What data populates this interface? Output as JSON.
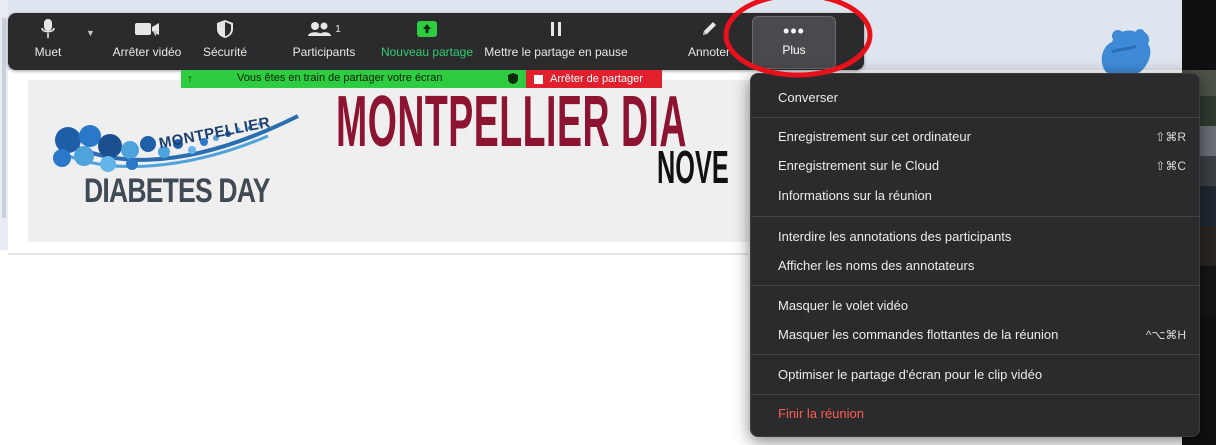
{
  "toolbar": {
    "mute_label": "Muet",
    "video_label": "Arrêter vidéo",
    "security_label": "Sécurité",
    "participants_label": "Participants",
    "participants_count": "1",
    "new_share_label": "Nouveau partage",
    "pause_share_label": "Mettre le partage en pause",
    "annotate_label": "Annoter",
    "more_label": "Plus",
    "more_dots": "•••"
  },
  "share_bar": {
    "status_text": "Vous êtes en train de partager votre écran",
    "stop_label": "Arrêter de partager"
  },
  "banner": {
    "logo_top": "MONTPELLIER",
    "logo_bottom": "DIABETES DAY",
    "title": "MONTPELLIER DIA",
    "date": "NOVE"
  },
  "menu": {
    "items": [
      {
        "label": "Converser",
        "shortcut": ""
      },
      {
        "label": "Enregistrement sur cet ordinateur",
        "shortcut": "⇧⌘R"
      },
      {
        "label": "Enregistrement sur le Cloud",
        "shortcut": "⇧⌘C"
      },
      {
        "label": "Informations sur la réunion",
        "shortcut": ""
      },
      {
        "label": "Interdire les annotations des participants",
        "shortcut": ""
      },
      {
        "label": "Afficher les noms des annotateurs",
        "shortcut": ""
      },
      {
        "label": "Masquer le volet vidéo",
        "shortcut": ""
      },
      {
        "label": "Masquer les commandes flottantes de la réunion",
        "shortcut": "^⌥⌘H"
      },
      {
        "label": "Optimiser le partage d'écran pour le clip vidéo",
        "shortcut": ""
      },
      {
        "label": "Finir la réunion",
        "shortcut": ""
      }
    ]
  },
  "colors": {
    "toolbar_bg": "#2b2b2d",
    "share_green": "#2ecc40",
    "stop_red": "#e0202d",
    "danger_text": "#ff5a50",
    "annotation_red": "#e8111b",
    "banner_title": "#8c1430"
  },
  "icons": {
    "mute": "microphone-icon",
    "video": "video-camera-icon",
    "security": "shield-icon",
    "participants": "people-icon",
    "new_share": "share-screen-up-arrow-icon",
    "pause": "pause-icon",
    "annotate": "pencil-icon",
    "more": "ellipsis-icon"
  }
}
